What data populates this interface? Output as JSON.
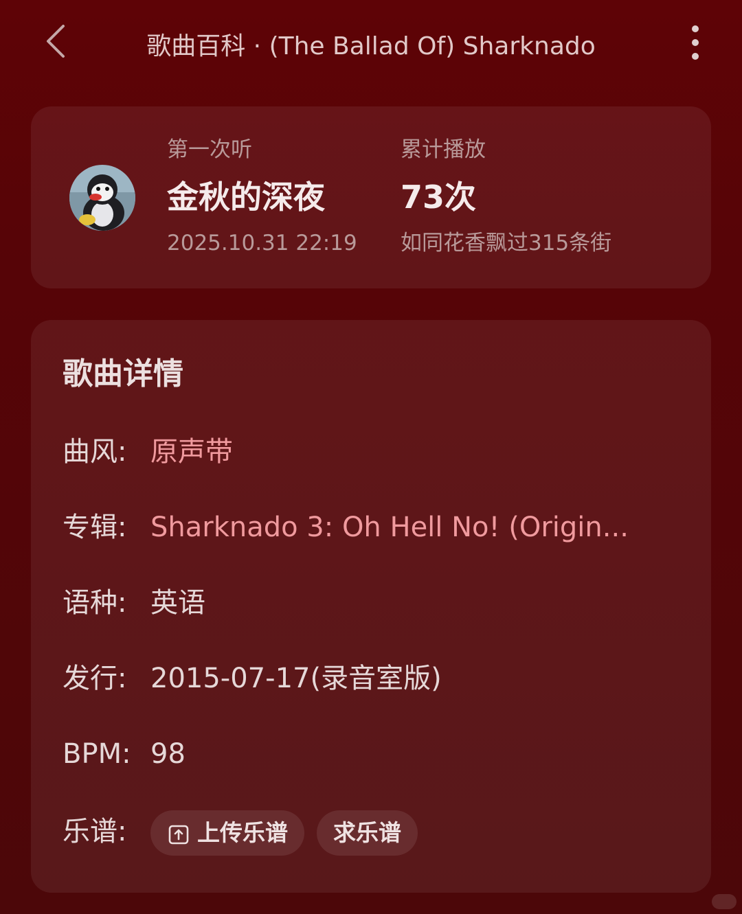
{
  "header": {
    "title": "歌曲百科 · (The Ballad Of) Sharknado",
    "back_icon": "chevron-left-icon",
    "more_icon": "more-vertical-icon"
  },
  "listen_stats": {
    "first_listen": {
      "label": "第一次听",
      "value": "金秋的深夜",
      "detail": "2025.10.31 22:19"
    },
    "total_plays": {
      "label": "累计播放",
      "value": "73次",
      "detail": "如同花香飘过315条街"
    }
  },
  "song_details": {
    "heading": "歌曲详情",
    "genre": {
      "key": "曲风:",
      "value": "原声带"
    },
    "album": {
      "key": "专辑:",
      "value": "Sharknado 3: Oh Hell No! (Origin..."
    },
    "language": {
      "key": "语种:",
      "value": "英语"
    },
    "release": {
      "key": "发行:",
      "value": "2015-07-17(录音室版)"
    },
    "bpm": {
      "key": "BPM:",
      "value": "98"
    },
    "sheet_music": {
      "key": "乐谱:",
      "upload_label": "上传乐谱",
      "request_label": "求乐谱"
    }
  },
  "colors": {
    "background": "#5a0407",
    "link_accent": "#f09a9e"
  }
}
